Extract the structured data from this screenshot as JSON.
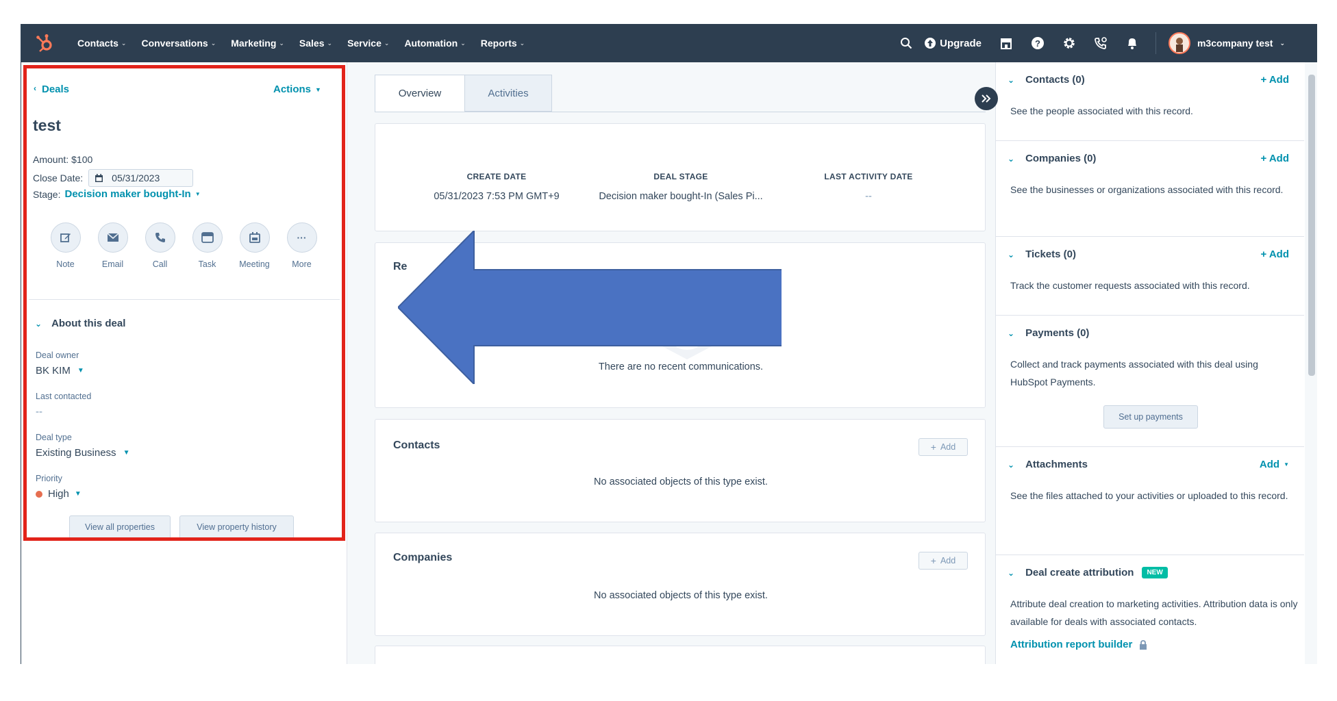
{
  "nav": {
    "items": [
      "Contacts",
      "Conversations",
      "Marketing",
      "Sales",
      "Service",
      "Automation",
      "Reports"
    ],
    "upgrade_label": "Upgrade",
    "account_name": "m3company test",
    "icons": [
      "search-icon",
      "marketplace-icon",
      "help-icon",
      "settings-icon",
      "calling-icon",
      "notifications-icon"
    ]
  },
  "record": {
    "back_label": "Deals",
    "actions_label": "Actions",
    "deal_name": "test",
    "amount_label": "Amount:",
    "amount_value": "$100",
    "close_date_label": "Close Date:",
    "close_date_value": "05/31/2023",
    "stage_label": "Stage:",
    "stage_value": "Decision maker bought-In",
    "quick_actions": [
      "Note",
      "Email",
      "Call",
      "Task",
      "Meeting",
      "More"
    ]
  },
  "about": {
    "heading": "About this deal",
    "deal_owner_label": "Deal owner",
    "deal_owner_value": "BK KIM",
    "last_contacted_label": "Last contacted",
    "last_contacted_value": "--",
    "deal_type_label": "Deal type",
    "deal_type_value": "Existing Business",
    "priority_label": "Priority",
    "priority_value": "High",
    "view_all_label": "View all properties",
    "view_history_label": "View property history"
  },
  "tabs": {
    "overview": "Overview",
    "activities": "Activities"
  },
  "highlights": {
    "create_date_label": "CREATE DATE",
    "create_date_value": "05/31/2023 7:53 PM GMT+9",
    "deal_stage_label": "DEAL STAGE",
    "deal_stage_value": "Decision maker bought-In (Sales Pi...",
    "last_activity_label": "LAST ACTIVITY DATE",
    "last_activity_value": "--"
  },
  "recent": {
    "title_partial": "Re",
    "empty_text": "There are no recent communications."
  },
  "contacts_card": {
    "title": "Contacts",
    "add_label": "Add",
    "empty_text": "No associated objects of this type exist."
  },
  "companies_card": {
    "title": "Companies",
    "add_label": "Add",
    "empty_text": "No associated objects of this type exist."
  },
  "sidebar": {
    "contacts_title": "Contacts (0)",
    "contacts_add": "+ Add",
    "contacts_desc": "See the people associated with this record.",
    "companies_title": "Companies (0)",
    "companies_add": "+ Add",
    "companies_desc": "See the businesses or organizations associated with this record.",
    "tickets_title": "Tickets (0)",
    "tickets_add": "+ Add",
    "tickets_desc": "Track the customer requests associated with this record.",
    "payments_title": "Payments (0)",
    "payments_desc": "Collect and track payments associated with this deal using HubSpot Payments.",
    "payments_button": "Set up payments",
    "attachments_title": "Attachments",
    "attachments_add": "Add",
    "attachments_desc": "See the files attached to your activities or uploaded to this record.",
    "attribution_title": "Deal create attribution",
    "attribution_badge": "NEW",
    "attribution_desc": "Attribute deal creation to marketing activities. Attribution data is only available for deals with associated contacts.",
    "attribution_link": "Attribution report builder"
  },
  "colors": {
    "nav_bg": "#2d3e50",
    "link": "#0091ae",
    "highlight_border": "#e2231a",
    "arrow_fill": "#4a72c2",
    "priority_dot": "#e66e50",
    "badge": "#00bda5"
  }
}
